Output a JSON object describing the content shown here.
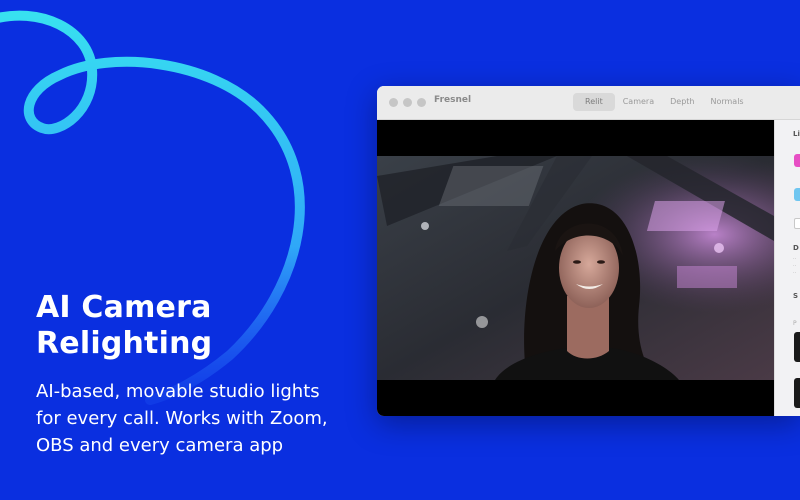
{
  "hero": {
    "title_line1": "AI Camera",
    "title_line2": "Relighting",
    "desc_line1": "AI-based, movable studio lights",
    "desc_line2": "for every call. Works with Zoom,",
    "desc_line3": "OBS and every camera app"
  },
  "window": {
    "app_title": "Fresnel",
    "tabs": [
      {
        "label": "Relit",
        "active": true
      },
      {
        "label": "Camera",
        "active": false
      },
      {
        "label": "Depth",
        "active": false
      },
      {
        "label": "Normals",
        "active": false
      }
    ]
  },
  "inspector": {
    "section_lights": "Li",
    "section_d": "D",
    "section_s": "S",
    "section_p": "P",
    "swatch_pink": "#e74fc4",
    "swatch_blue": "#6fc6f0"
  },
  "colors": {
    "background": "#0a2fe0",
    "swoosh_start": "#38e0f0",
    "swoosh_end": "#2a7bff"
  }
}
